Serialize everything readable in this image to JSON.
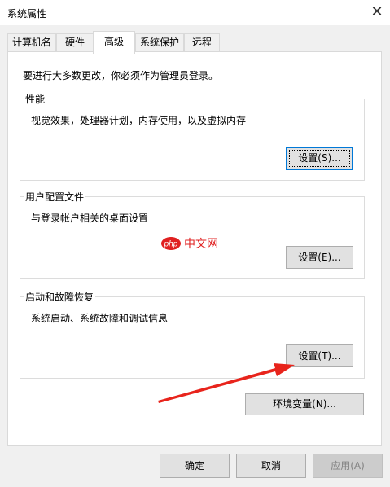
{
  "window": {
    "title": "系统属性",
    "close_glyph": "✕"
  },
  "tabs": [
    {
      "label": "计算机名"
    },
    {
      "label": "硬件"
    },
    {
      "label": "高级"
    },
    {
      "label": "系统保护"
    },
    {
      "label": "远程"
    }
  ],
  "admin_note": "要进行大多数更改，你必须作为管理员登录。",
  "performance": {
    "label": "性能",
    "description": "视觉效果，处理器计划，内存使用，以及虚拟内存",
    "button": "设置(S)..."
  },
  "user_profiles": {
    "label": "用户配置文件",
    "description": "与登录帐户相关的桌面设置",
    "button": "设置(E)..."
  },
  "startup_recovery": {
    "label": "启动和故障恢复",
    "description": "系统启动、系统故障和调试信息",
    "button": "设置(T)..."
  },
  "env_button": "环境变量(N)...",
  "footer": {
    "ok": "确定",
    "cancel": "取消",
    "apply": "应用(A)"
  },
  "watermark": {
    "brand": "php",
    "text": "中文网",
    "color": "#e02020"
  },
  "colors": {
    "accent": "#0078d7",
    "arrow": "#e8241c"
  }
}
